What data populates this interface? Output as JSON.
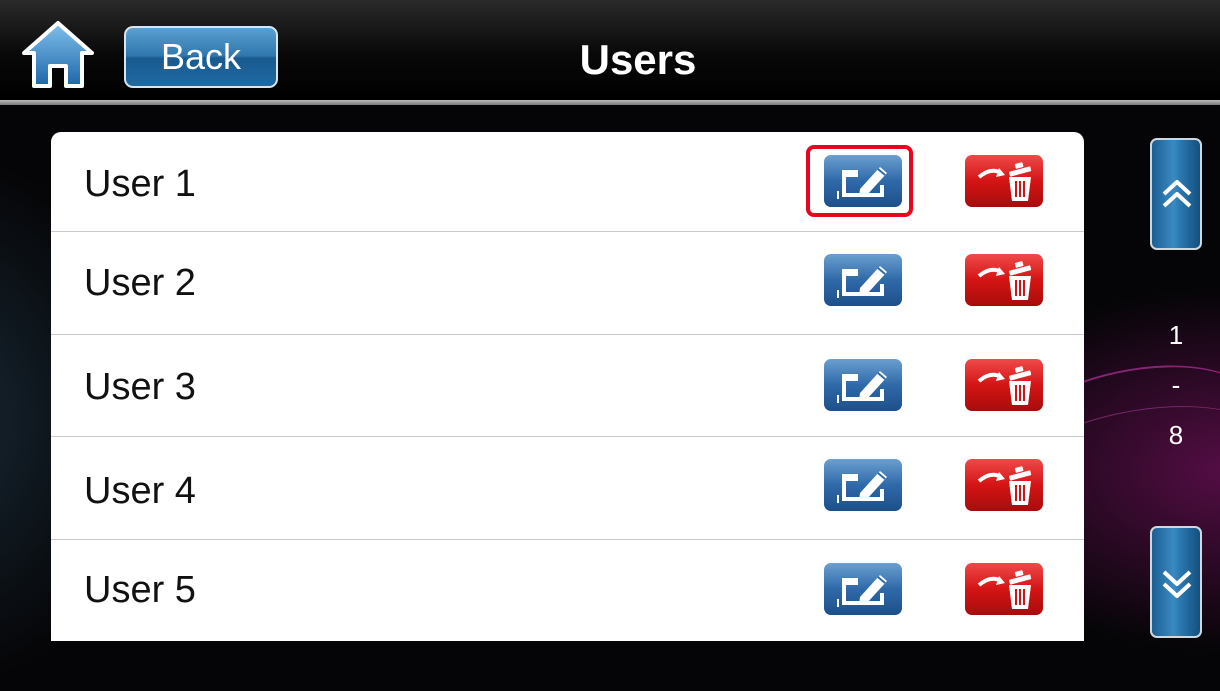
{
  "header": {
    "title": "Users",
    "back_label": "Back",
    "home_icon": "home-icon"
  },
  "users": {
    "items": [
      {
        "label": "User 1",
        "selected_edit": true
      },
      {
        "label": "User 2",
        "selected_edit": false
      },
      {
        "label": "User 3",
        "selected_edit": false
      },
      {
        "label": "User 4",
        "selected_edit": false
      },
      {
        "label": "User 5",
        "selected_edit": false
      }
    ],
    "edit_icon": "edit-icon",
    "delete_icon": "delete-trash-icon"
  },
  "pager": {
    "from": "1",
    "separator": "-",
    "to": "8",
    "up_icon": "double-chevron-up-icon",
    "down_icon": "double-chevron-down-icon"
  },
  "colors": {
    "accent_blue": "#2f77ad",
    "delete_red": "#d41414",
    "highlight_red": "#e8061c",
    "background": "#050507"
  }
}
